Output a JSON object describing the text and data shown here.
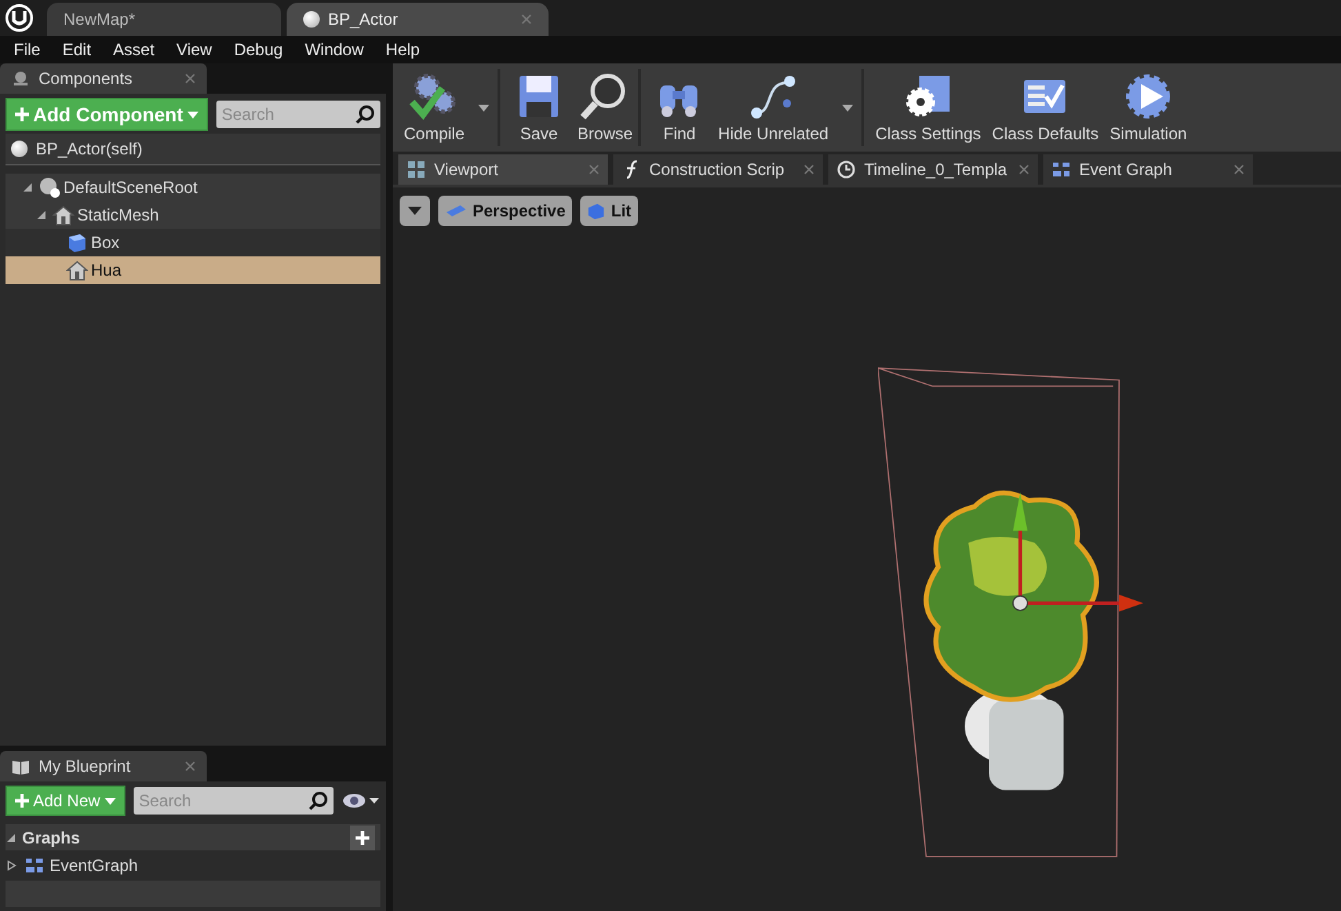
{
  "doc_tabs": [
    {
      "label": "NewMap*",
      "selected": false,
      "closable": false
    },
    {
      "label": "BP_Actor",
      "selected": true,
      "closable": true
    }
  ],
  "menu": [
    "File",
    "Edit",
    "Asset",
    "View",
    "Debug",
    "Window",
    "Help"
  ],
  "components_panel": {
    "title": "Components",
    "add_button": "Add Component",
    "search": {
      "placeholder": "Search"
    },
    "root": "BP_Actor(self)",
    "tree": [
      {
        "label": "DefaultSceneRoot",
        "kind": "scene",
        "expanded": true,
        "selected": false,
        "children": [
          {
            "label": "StaticMesh",
            "kind": "mesh",
            "expanded": true,
            "selected": false,
            "children": [
              {
                "label": "Box",
                "kind": "box",
                "selected": false
              },
              {
                "label": "Hua",
                "kind": "mesh",
                "selected": true
              }
            ]
          }
        ]
      }
    ]
  },
  "toolbar": [
    {
      "label": "Compile",
      "kind": "compile",
      "dropdown": true
    },
    {
      "label": "Save",
      "kind": "save"
    },
    {
      "label": "Browse",
      "kind": "browse"
    },
    {
      "label": "Find",
      "kind": "find"
    },
    {
      "label": "Hide Unrelated",
      "kind": "hide",
      "dropdown": true
    },
    {
      "label": "Class Settings",
      "kind": "settings"
    },
    {
      "label": "Class Defaults",
      "kind": "defaults"
    },
    {
      "label": "Simulation",
      "kind": "simulation"
    }
  ],
  "editor_tabs": [
    {
      "label": "Viewport",
      "kind": "viewport",
      "selected": true
    },
    {
      "label": "Construction Scrip",
      "kind": "function",
      "selected": false
    },
    {
      "label": "Timeline_0_Templa",
      "kind": "timeline",
      "selected": false
    },
    {
      "label": "Event Graph",
      "kind": "graph",
      "selected": false
    }
  ],
  "viewport": {
    "view_mode": "Perspective",
    "lighting": "Lit"
  },
  "my_blueprint": {
    "title": "My Blueprint",
    "add_button": "Add New",
    "search": {
      "placeholder": "Search"
    },
    "sections": [
      {
        "title": "Graphs",
        "items": [
          "EventGraph"
        ]
      }
    ]
  }
}
